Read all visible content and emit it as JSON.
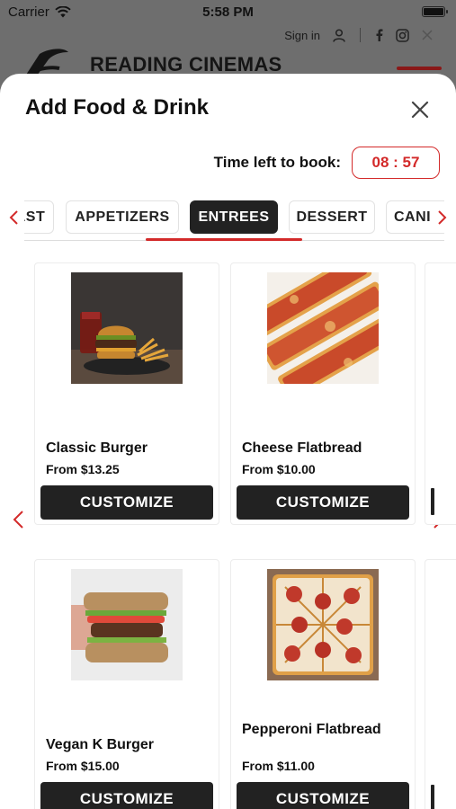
{
  "status_bar": {
    "carrier": "Carrier",
    "time": "5:58 PM"
  },
  "site_header": {
    "signin_label": "Sign in",
    "brand": "READING CINEMAS"
  },
  "sheet": {
    "title": "Add Food & Drink",
    "timer_label": "Time left to book:",
    "timer_value": "08 : 57"
  },
  "tabs": [
    {
      "label": "AST"
    },
    {
      "label": "APPETIZERS"
    },
    {
      "label": "ENTREES"
    },
    {
      "label": "DESSERT"
    },
    {
      "label": "CANI"
    }
  ],
  "products": [
    {
      "name": "Classic Burger",
      "price": "From $13.25",
      "button": "CUSTOMIZE"
    },
    {
      "name": "Cheese Flatbread",
      "price": "From $10.00",
      "button": "CUSTOMIZE"
    },
    {
      "name": "Vegan K Burger",
      "price": "From $15.00",
      "button": "CUSTOMIZE"
    },
    {
      "name": "Pepperoni Flatbread",
      "price": "From $11.00",
      "button": "CUSTOMIZE"
    }
  ],
  "icons": {
    "wifi": "wifi-icon",
    "battery": "battery-icon",
    "user": "user-icon",
    "facebook": "facebook-icon",
    "instagram": "instagram-icon",
    "x": "x-social-icon",
    "close": "close-icon",
    "chevron_left": "chevron-left-icon",
    "chevron_right": "chevron-right-icon"
  },
  "colors": {
    "accent": "#d32a2a",
    "button": "#222222"
  }
}
